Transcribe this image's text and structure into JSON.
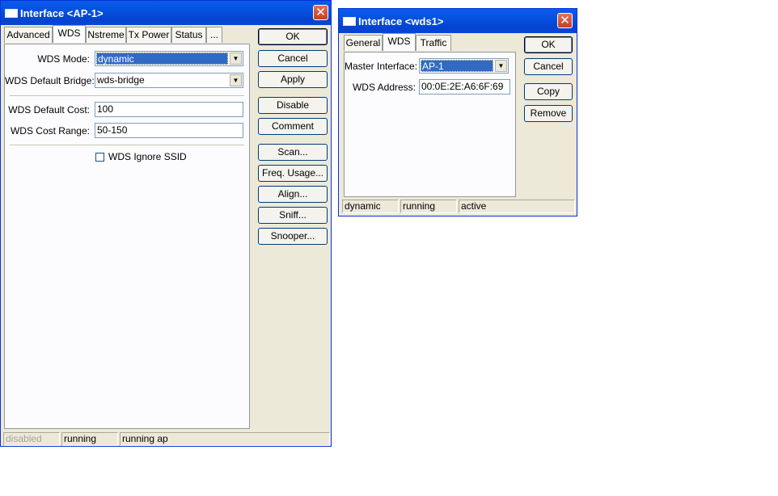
{
  "ap_window": {
    "title": "Interface <AP-1>",
    "tabs": [
      "Advanced",
      "WDS",
      "Nstreme",
      "Tx Power",
      "Status",
      "..."
    ],
    "active_tab": "WDS",
    "fields": {
      "wds_mode_label": "WDS Mode:",
      "wds_mode_value": "dynamic",
      "default_bridge_label": "WDS Default Bridge:",
      "default_bridge_value": "wds-bridge",
      "default_cost_label": "WDS Default Cost:",
      "default_cost_value": "100",
      "cost_range_label": "WDS Cost Range:",
      "cost_range_value": "50-150",
      "ignore_ssid_label": "WDS Ignore SSID",
      "ignore_ssid_checked": false
    },
    "buttons": [
      "OK",
      "Cancel",
      "Apply",
      "Disable",
      "Comment",
      "Scan...",
      "Freq. Usage...",
      "Align...",
      "Sniff...",
      "Snooper..."
    ],
    "status": [
      "disabled",
      "running",
      "running ap"
    ]
  },
  "wds_window": {
    "title": "Interface <wds1>",
    "tabs": [
      "General",
      "WDS",
      "Traffic"
    ],
    "active_tab": "WDS",
    "fields": {
      "master_interface_label": "Master Interface:",
      "master_interface_value": "AP-1",
      "wds_address_label": "WDS Address:",
      "wds_address_value": "00:0E:2E:A6:6F:69"
    },
    "buttons": [
      "OK",
      "Cancel",
      "Copy",
      "Remove"
    ],
    "status": [
      "dynamic",
      "running",
      "active"
    ]
  },
  "icons": {
    "close": "close-icon",
    "window": "window-icon",
    "dropdown": "chevron-down-icon"
  },
  "colors": {
    "titlebar": "#0a5be8",
    "face": "#ece9d8",
    "selection": "#316ac5",
    "close": "#c53e22"
  }
}
